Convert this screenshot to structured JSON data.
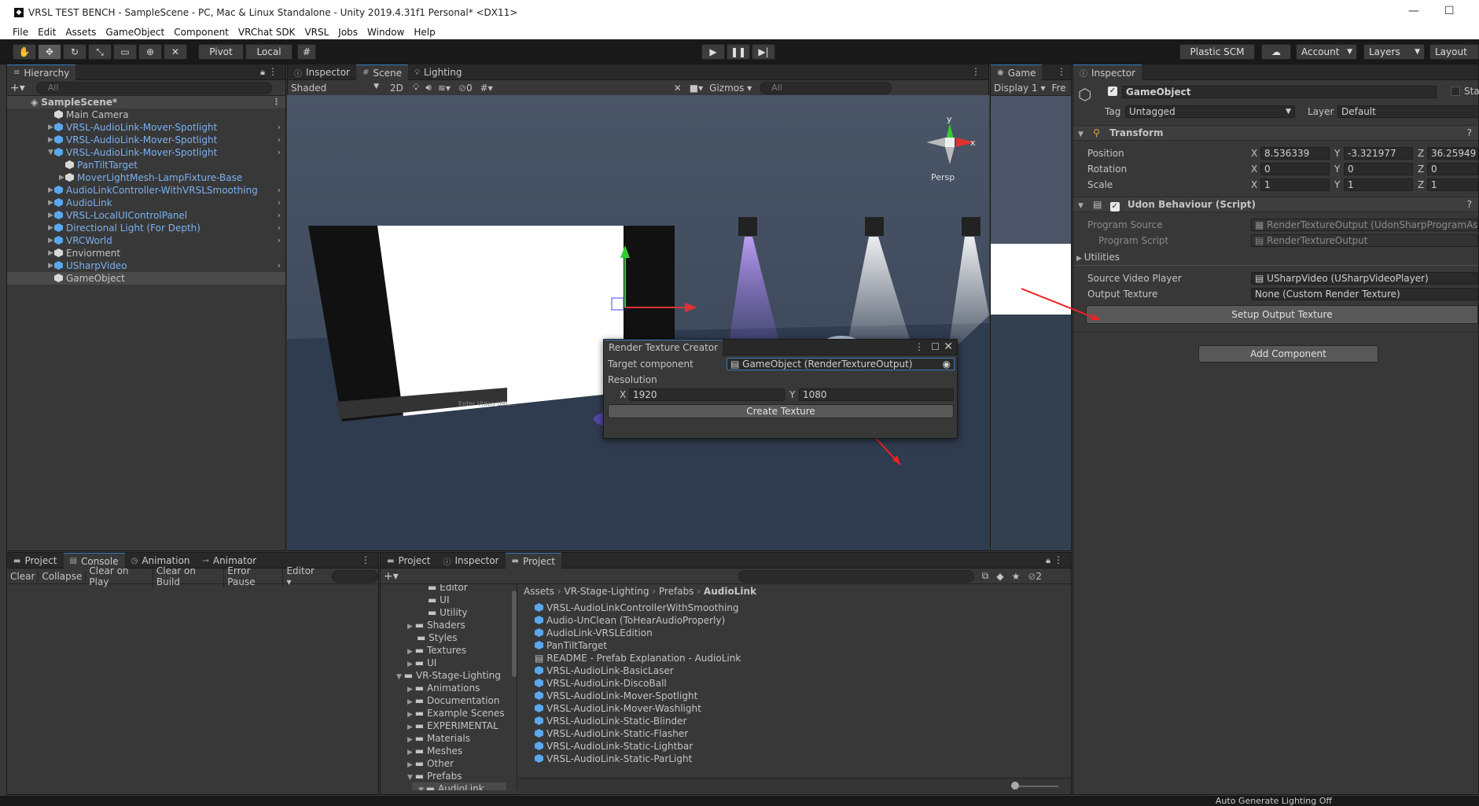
{
  "window": {
    "title": "VRSL TEST BENCH - SampleScene - PC, Mac & Linux Standalone - Unity 2019.4.31f1 Personal* <DX11>"
  },
  "menu": [
    "File",
    "Edit",
    "Assets",
    "GameObject",
    "Component",
    "VRChat SDK",
    "VRSL",
    "Jobs",
    "Window",
    "Help"
  ],
  "toolbar": {
    "pivot": "Pivot",
    "local": "Local",
    "plastic": "Plastic SCM",
    "account": "Account",
    "layers": "Layers",
    "layout": "Layout"
  },
  "hierarchy": {
    "tab": "Hierarchy",
    "search": "All",
    "scene": "SampleScene*",
    "items": [
      "Main Camera",
      "VRSL-AudioLink-Mover-Spotlight",
      "VRSL-AudioLink-Mover-Spotlight",
      "VRSL-AudioLink-Mover-Spotlight",
      "PanTiltTarget",
      "MoverLightMesh-LampFixture-Base",
      "AudioLinkController-WithVRSLSmoothing",
      "AudioLink",
      "VRSL-LocalUIControlPanel",
      "Directional Light (For Depth)",
      "VRCWorld",
      "Enviorment",
      "USharpVideo",
      "GameObject"
    ]
  },
  "sceneTabs": {
    "inspector": "Inspector",
    "scene": "Scene",
    "lighting": "Lighting",
    "shaded": "Shaded",
    "twoD": "2D",
    "gizmos": "Gizmos",
    "search": "All",
    "persp": "Persp",
    "hidden": "0",
    "axis_y": "y",
    "axis_x": "x",
    "video_status": "Enter Video URL..."
  },
  "gameTab": {
    "label": "Game",
    "display": "Display 1",
    "free": "Fre"
  },
  "rtc": {
    "title": "Render Texture Creator",
    "target_label": "Target component",
    "target_value": "GameObject (RenderTextureOutput)",
    "resolution": "Resolution",
    "x_label": "X",
    "x": "1920",
    "y_label": "Y",
    "y": "1080",
    "create": "Create Texture"
  },
  "inspector": {
    "tab": "Inspector",
    "name": "GameObject",
    "static": "Sta",
    "tag_label": "Tag",
    "tag": "Untagged",
    "layer_label": "Layer",
    "layer": "Default",
    "transform": "Transform",
    "position_label": "Position",
    "px": "8.536339",
    "py": "-3.321977",
    "pz": "36.25949",
    "rotation_label": "Rotation",
    "rx": "0",
    "ry": "0",
    "rz": "0",
    "scale_label": "Scale",
    "sx": "1",
    "sy": "1",
    "sz": "1",
    "x": "X",
    "y": "Y",
    "z": "Z",
    "udon": "Udon Behaviour (Script)",
    "program_source_label": "Program Source",
    "program_source": "RenderTextureOutput (UdonSharpProgramAsset)",
    "program_script_label": "Program Script",
    "program_script": "RenderTextureOutput",
    "utilities": "Utilities",
    "source_video_label": "Source Video Player",
    "source_video": "USharpVideo (USharpVideoPlayer)",
    "output_texture_label": "Output Texture",
    "output_texture": "None (Custom Render Texture)",
    "setup_btn": "Setup Output Texture",
    "add_component": "Add Component"
  },
  "console": {
    "tabs": [
      "Project",
      "Console",
      "Animation",
      "Animator"
    ],
    "buttons": [
      "Clear",
      "Collapse",
      "Clear on Play",
      "Clear on Build",
      "Error Pause",
      "Editor"
    ]
  },
  "project": {
    "tabs": [
      "Project",
      "Inspector",
      "Project"
    ],
    "breadcrumb": [
      "Assets",
      "VR-Stage-Lighting",
      "Prefabs",
      "AudioLink"
    ],
    "hidden_count": "2",
    "tree": [
      "Editor",
      "UI",
      "Utility",
      "Shaders",
      "Styles",
      "Textures",
      "UI",
      "VR-Stage-Lighting",
      "Animations",
      "Documentation",
      "Example Scenes",
      "EXPERIMENTAL",
      "Materials",
      "Meshes",
      "Other",
      "Prefabs",
      "AudioLink"
    ],
    "files": [
      "VRSL-AudioLinkControllerWithSmoothing",
      "Audio-UnClean (ToHearAudioProperly)",
      "AudioLink-VRSLEdition",
      "PanTiltTarget",
      "README - Prefab Explanation - AudioLink",
      "VRSL-AudioLink-BasicLaser",
      "VRSL-AudioLink-DiscoBall",
      "VRSL-AudioLink-Mover-Spotlight",
      "VRSL-AudioLink-Mover-Washlight",
      "VRSL-AudioLink-Static-Blinder",
      "VRSL-AudioLink-Static-Flasher",
      "VRSL-AudioLink-Static-Lightbar",
      "VRSL-AudioLink-Static-ParLight"
    ]
  },
  "status": {
    "text": "Auto Generate Lighting Off"
  }
}
